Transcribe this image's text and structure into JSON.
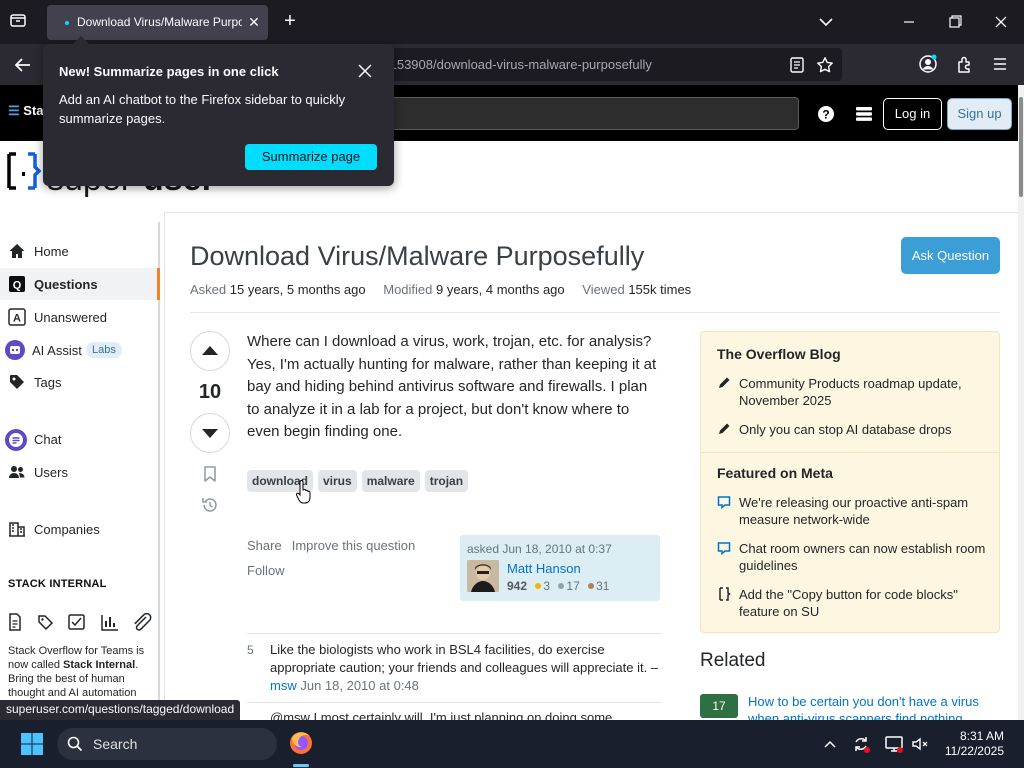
{
  "browser": {
    "tab_title": "Download Virus/Malware Purpose",
    "url_visible": "/153908/download-virus-malware-purposefully",
    "status_url": "superuser.com/questions/tagged/download"
  },
  "popup": {
    "title": "New! Summarize pages in one click",
    "body": "Add an AI chatbot to the Firefox sidebar to quickly summarize pages.",
    "button": "Summarize page"
  },
  "site_header": {
    "logo_text": "Sta",
    "login": "Log in",
    "signup": "Sign up"
  },
  "sidebar": {
    "items": [
      {
        "label": "Home",
        "icon": "home-icon"
      },
      {
        "label": "Questions",
        "icon": "questions-icon",
        "active": true
      },
      {
        "label": "Unanswered",
        "icon": "unanswered-icon"
      },
      {
        "label": "AI Assist",
        "icon": "ai-assist-icon",
        "badge": "Labs"
      },
      {
        "label": "Tags",
        "icon": "tag-icon"
      },
      {
        "label": "Chat",
        "icon": "chat-icon"
      },
      {
        "label": "Users",
        "icon": "users-icon"
      },
      {
        "label": "Companies",
        "icon": "companies-icon"
      }
    ],
    "stack_internal_heading": "STACK INTERNAL",
    "stack_internal_text_1": "Stack Overflow for Teams is now called ",
    "stack_internal_bold": "Stack Internal",
    "stack_internal_text_2": ". Bring the best of human thought and AI automation"
  },
  "question": {
    "title": "Download Virus/Malware Purposefully",
    "ask_button": "Ask Question",
    "asked_label": "Asked",
    "asked_value": "15 years, 5 months ago",
    "modified_label": "Modified",
    "modified_value": "9 years, 4 months ago",
    "viewed_label": "Viewed",
    "viewed_value": "155k times",
    "votes": "10",
    "body": "Where can I download a virus, work, trojan, etc. for analysis? Yes, I'm actually hunting for malware, rather than keeping it at bay and hiding behind antivirus software and firewalls. I plan to analyze it in a lab for a project, but don't know where to even begin finding one.",
    "tags": [
      "download",
      "virus",
      "malware",
      "trojan"
    ],
    "share": "Share",
    "improve": "Improve this question",
    "follow": "Follow",
    "user_card": {
      "asked": "asked Jun 18, 2010 at 0:37",
      "name": "Matt Hanson",
      "rep": "942",
      "gold": "3",
      "silver": "17",
      "bronze": "31"
    }
  },
  "comments": [
    {
      "score": "5",
      "text": "Like the biologists who work in BSL4 facilities, do exercise appropriate caution; your friends and colleagues will appreciate it. – ",
      "user": "msw",
      "date": "Jun 18, 2010 at 0:48"
    },
    {
      "text": "@msw I most certainly will. I'm just planning on doing some"
    }
  ],
  "right_sidebar": {
    "blog_heading": "The Overflow Blog",
    "blog_items": [
      "Community Products roadmap update, November 2025",
      "Only you can stop AI database drops"
    ],
    "meta_heading": "Featured on Meta",
    "meta_items": [
      "We're releasing our proactive anti-spam measure network-wide",
      "Chat room owners can now establish room guidelines",
      "Add the \"Copy button for code blocks\" feature on SU"
    ],
    "related_heading": "Related",
    "related": [
      {
        "score": "17",
        "title": "How to be certain you don't have a virus when anti-virus scanners find nothing"
      }
    ]
  },
  "taskbar": {
    "search_label": "Search",
    "time": "8:31 AM",
    "date": "11/22/2025"
  },
  "colors": {
    "accent_orange": "#f48225",
    "ask_button": "#3c9ed6",
    "link_blue": "#0074cc",
    "blog_bg": "#fdf7e2",
    "popup_button": "#00ddff"
  }
}
